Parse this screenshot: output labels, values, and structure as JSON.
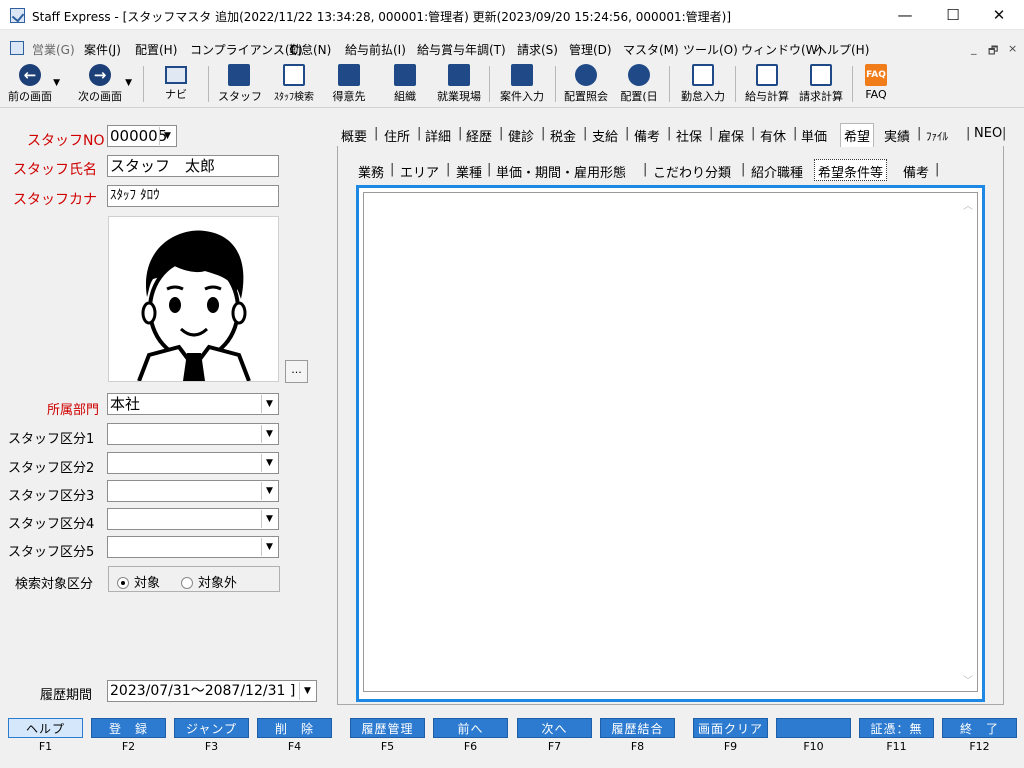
{
  "window": {
    "title": "Staff Express - [スタッフマスタ 追加(2022/11/22 13:34:28, 000001:管理者) 更新(2023/09/20 15:24:56, 000001:管理者)]",
    "minimize": "—",
    "maximize": "☐",
    "close": "✕"
  },
  "menu": [
    "営業(G)",
    "案件(J)",
    "配置(H)",
    "コンプライアンス(C)",
    "勤怠(N)",
    "給与前払(I)",
    "給与賞与年調(T)",
    "請求(S)",
    "管理(D)",
    "マスタ(M)",
    "ツール(O)",
    "ウィンドウ(W)",
    "ヘルプ(H)"
  ],
  "mdi_controls": [
    "_",
    "🗗",
    "×"
  ],
  "toolbar": [
    {
      "label": "前の画面",
      "icon": "back-arrow-icon"
    },
    {
      "label": "次の画面",
      "icon": "forward-arrow-icon"
    },
    {
      "label": "ナビ",
      "icon": "navi-icon"
    },
    {
      "label": "スタッフ",
      "icon": "staff-icon"
    },
    {
      "label": "ｽﾀｯﾌ検索",
      "icon": "staff-search-icon"
    },
    {
      "label": "得意先",
      "icon": "client-icon"
    },
    {
      "label": "組織",
      "icon": "organization-icon"
    },
    {
      "label": "就業現場",
      "icon": "worksite-icon"
    },
    {
      "label": "案件入力",
      "icon": "case-input-icon"
    },
    {
      "label": "配置照会",
      "icon": "placement-inquiry-icon"
    },
    {
      "label": "配置(日",
      "icon": "placement-daily-icon"
    },
    {
      "label": "勤怠入力",
      "icon": "attendance-input-icon"
    },
    {
      "label": "給与計算",
      "icon": "payroll-icon"
    },
    {
      "label": "請求計算",
      "icon": "billing-icon"
    },
    {
      "label": "FAQ",
      "icon": "faq-icon"
    }
  ],
  "staff": {
    "no_label": "スタッフNO",
    "no_value": "000005",
    "name_label": "スタッフ氏名",
    "name_value": "スタッフ　太郎",
    "kana_label": "スタッフカナ",
    "kana_value": "ｽﾀｯﾌ ﾀﾛｳ",
    "photo_button": "...",
    "dept_label": "所属部門",
    "dept_value": "本社",
    "categories": [
      {
        "label": "スタッフ区分1",
        "value": ""
      },
      {
        "label": "スタッフ区分2",
        "value": ""
      },
      {
        "label": "スタッフ区分3",
        "value": ""
      },
      {
        "label": "スタッフ区分4",
        "value": ""
      },
      {
        "label": "スタッフ区分5",
        "value": ""
      }
    ],
    "search_label": "検索対象区分",
    "search_on": "対象",
    "search_off": "対象外",
    "search_selected": "対象",
    "history_label": "履歴期間",
    "history_value": "2023/07/31～2087/12/31 ]"
  },
  "main_tabs": [
    "概要",
    "住所",
    "詳細",
    "経歴",
    "健診",
    "税金",
    "支給",
    "備考",
    "社保",
    "雇保",
    "有休",
    "単価",
    "希望",
    "実績",
    "ﾌｧｲﾙ",
    "NEO"
  ],
  "main_tab_active": "希望",
  "sub_tabs": [
    "業務",
    "エリア",
    "業種",
    "単価・期間・雇用形態",
    "こだわり分類",
    "紹介職種",
    "希望条件等",
    "備考"
  ],
  "sub_tab_active": "希望条件等",
  "fkeys": [
    {
      "label": "ヘルプ",
      "key": "F1"
    },
    {
      "label": "登　録",
      "key": "F2"
    },
    {
      "label": "ジャンプ",
      "key": "F3"
    },
    {
      "label": "削　除",
      "key": "F4"
    },
    {
      "label": "履歴管理",
      "key": "F5"
    },
    {
      "label": "前へ",
      "key": "F6"
    },
    {
      "label": "次へ",
      "key": "F7"
    },
    {
      "label": "履歴結合",
      "key": "F8"
    },
    {
      "label": "画面クリア",
      "key": "F9"
    },
    {
      "label": "",
      "key": "F10"
    },
    {
      "label": "証憑：無",
      "key": "F11"
    },
    {
      "label": "終　了",
      "key": "F12"
    }
  ],
  "colors": {
    "accent_blue": "#1e88e5",
    "fkey_blue": "#2d7bd0",
    "label_red": "#d00000"
  }
}
